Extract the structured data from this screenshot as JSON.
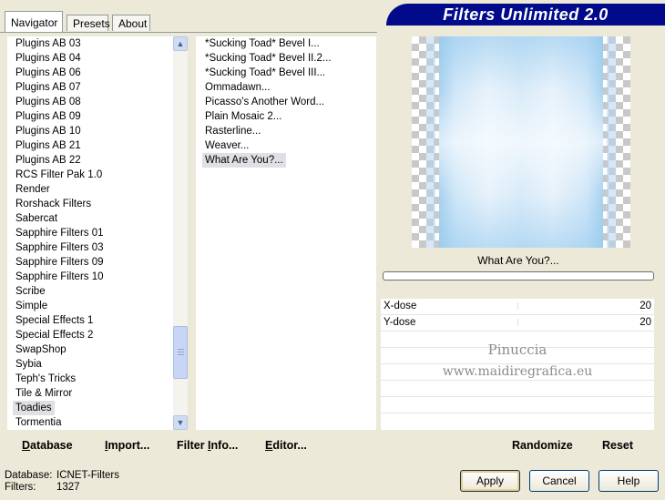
{
  "app": {
    "title": "Filters Unlimited 2.0"
  },
  "tabs": [
    "Navigator",
    "Presets",
    "About"
  ],
  "categories": [
    "Plugins AB 03",
    "Plugins AB 04",
    "Plugins AB 06",
    "Plugins AB 07",
    "Plugins AB 08",
    "Plugins AB 09",
    "Plugins AB 10",
    "Plugins AB 21",
    "Plugins AB 22",
    "RCS Filter Pak 1.0",
    "Render",
    "Rorshack Filters",
    "Sabercat",
    "Sapphire Filters 01",
    "Sapphire Filters 03",
    "Sapphire Filters 09",
    "Sapphire Filters 10",
    "Scribe",
    "Simple",
    "Special Effects 1",
    "Special Effects 2",
    "SwapShop",
    "Sybia",
    "Teph's Tricks",
    "Tile & Mirror",
    "Toadies",
    "Tormentia"
  ],
  "selected_category": "Toadies",
  "filters": [
    "*Sucking Toad*  Bevel I...",
    "*Sucking Toad*  Bevel II.2...",
    "*Sucking Toad*  Bevel III...",
    "Ommadawn...",
    "Picasso's Another Word...",
    "Plain Mosaic 2...",
    "Rasterline...",
    "Weaver...",
    "What Are You?..."
  ],
  "selected_filter": "What Are You?...",
  "preview": {
    "filter_name": "What Are You?...",
    "progress": 0.0
  },
  "params": [
    {
      "label": "X-dose",
      "value": "20"
    },
    {
      "label": "Y-dose",
      "value": "20"
    }
  ],
  "watermark": {
    "line1": "Pinuccia",
    "line2": "www.maidiregrafica.eu"
  },
  "toolbar": {
    "database": {
      "u": "D",
      "rest": "atabase"
    },
    "import": {
      "pre": "",
      "u": "I",
      "rest": "mport..."
    },
    "filter_info": {
      "pre": "Filter ",
      "u": "I",
      "rest": "nfo..."
    },
    "editor": {
      "pre": "",
      "u": "E",
      "rest": "ditor..."
    },
    "randomize": "Randomize",
    "reset": "Reset"
  },
  "status": {
    "database_label": "Database:",
    "database_value": "ICNET-Filters",
    "filters_label": "Filters:",
    "filters_value": "1327"
  },
  "buttons": {
    "apply": "Apply",
    "cancel": "Cancel",
    "help": "Help"
  },
  "colors": {
    "banner": "#000a8a",
    "selection": "#e0dfe3",
    "preview_blue": "#8fc6ec"
  }
}
